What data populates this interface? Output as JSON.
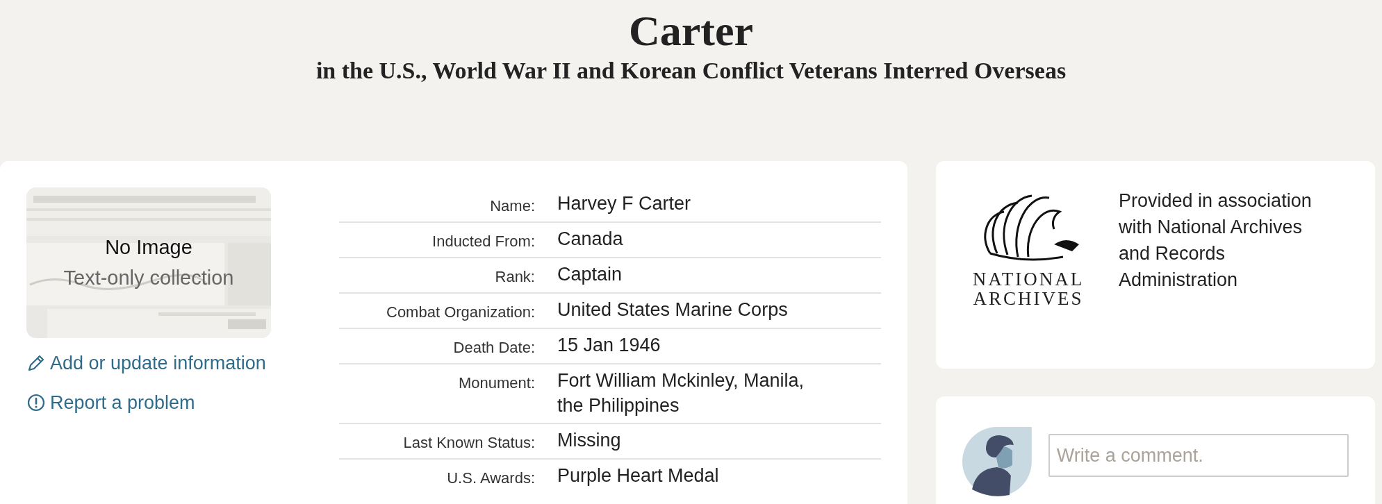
{
  "header": {
    "title": "Carter",
    "subtitle": "in the U.S., World War II and Korean Conflict Veterans Interred Overseas"
  },
  "record": {
    "thumbnail": {
      "kind": "picture",
      "title": "No Image",
      "caption": "Text-only collection"
    },
    "actions": [
      {
        "kind": "edit",
        "label": "Add or update information"
      },
      {
        "kind": "report",
        "label": "Report a problem"
      }
    ],
    "fields": [
      {
        "label": "Name:",
        "value": "Harvey F Carter"
      },
      {
        "label": "Inducted From:",
        "value": "Canada"
      },
      {
        "label": "Rank:",
        "value": "Captain"
      },
      {
        "label": "Combat Organization:",
        "value": "United States Marine Corps"
      },
      {
        "label": "Death Date:",
        "value": "15 Jan 1946"
      },
      {
        "label": "Monument:",
        "value": "Fort William Mckinley, Manila, the Philippines"
      },
      {
        "label": "Last Known Status:",
        "value": "Missing"
      },
      {
        "label": "U.S. Awards:",
        "value": "Purple Heart Medal"
      }
    ]
  },
  "provider": {
    "logo_lines": [
      "NATIONAL",
      "ARCHIVES"
    ],
    "text": "Provided in association with National Archives and Records Administration"
  },
  "comment": {
    "placeholder": "Write a comment."
  }
}
